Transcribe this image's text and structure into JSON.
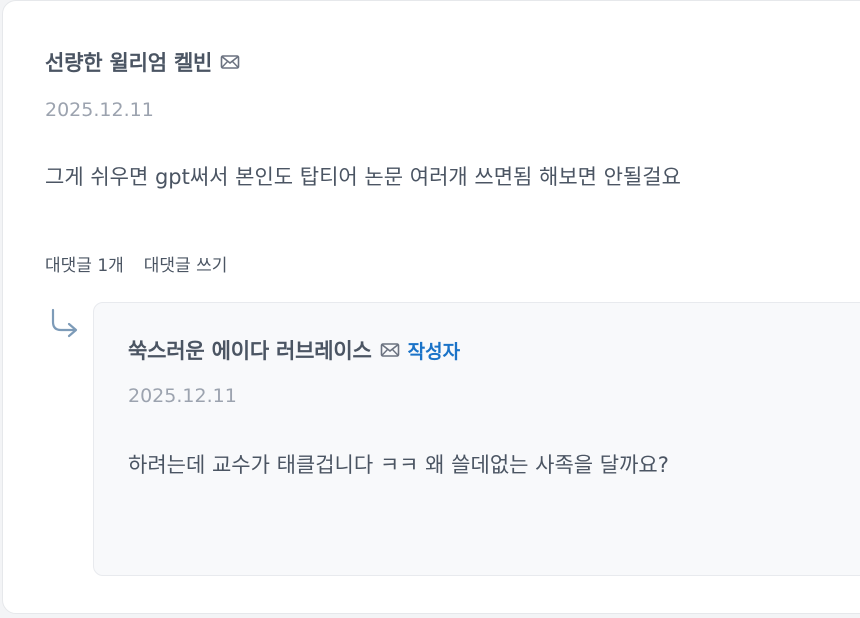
{
  "comment": {
    "author": "선량한 윌리엄 켈빈",
    "date": "2025.12.11",
    "text": "그게 쉬우면 gpt써서 본인도 탑티어 논문 여러개 쓰면됨 해보면 안될걸요",
    "reply_count_label": "대댓글 1개",
    "write_reply_label": "대댓글 쓰기",
    "icons": {
      "message": "mail-icon",
      "reply_indicator": "reply-arrow-icon"
    }
  },
  "reply": {
    "author": "쑥스러운 에이다 러브레이스",
    "badge": "작성자",
    "date": "2025.12.11",
    "text": "하려는데 교수가 태클겁니다 ㅋㅋ 왜 쓸데없는 사족을 달까요?"
  },
  "colors": {
    "badge": "#1a73c8",
    "text": "#4b5563",
    "muted": "#9ca3af"
  }
}
